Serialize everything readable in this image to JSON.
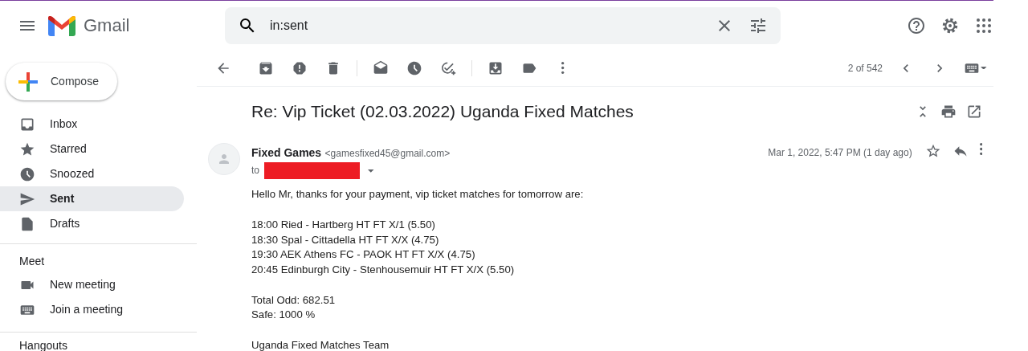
{
  "app_name": "Gmail",
  "search": {
    "value": "in:sent"
  },
  "compose": "Compose",
  "sidebar": {
    "items": [
      {
        "label": "Inbox",
        "selected": false
      },
      {
        "label": "Starred",
        "selected": false
      },
      {
        "label": "Snoozed",
        "selected": false
      },
      {
        "label": "Sent",
        "selected": true
      },
      {
        "label": "Drafts",
        "selected": false
      }
    ]
  },
  "meet": {
    "title": "Meet",
    "items": [
      "New meeting",
      "Join a meeting"
    ]
  },
  "hangouts": {
    "title": "Hangouts"
  },
  "toolbar": {
    "pagination": "2 of 542"
  },
  "email": {
    "subject": "Re: Vip Ticket (02.03.2022) Uganda Fixed Matches",
    "sender_name": "Fixed Games",
    "sender_email": "<gamesfixed45@gmail.com>",
    "to_label": "to",
    "recipient_redacted": true,
    "date": "Mar 1, 2022, 5:47 PM (1 day ago)",
    "starred": false,
    "body": [
      [
        "Hello Mr, thanks for your payment, vip ticket matches for tomorrow are:"
      ],
      [
        "18:00 Ried - Hartberg HT FT X/1 (5.50)",
        "18:30 Spal - Cittadella HT FT X/X (4.75)",
        "19:30 AEK Athens FC - PAOK HT FT X/X (4.75)",
        "20:45 Edinburgh City - Stenhousemuir HT FT X/X (5.50)"
      ],
      [
        "Total Odd: 682.51",
        "Safe: 1000 %"
      ],
      [
        "Uganda Fixed Matches Team"
      ]
    ]
  }
}
